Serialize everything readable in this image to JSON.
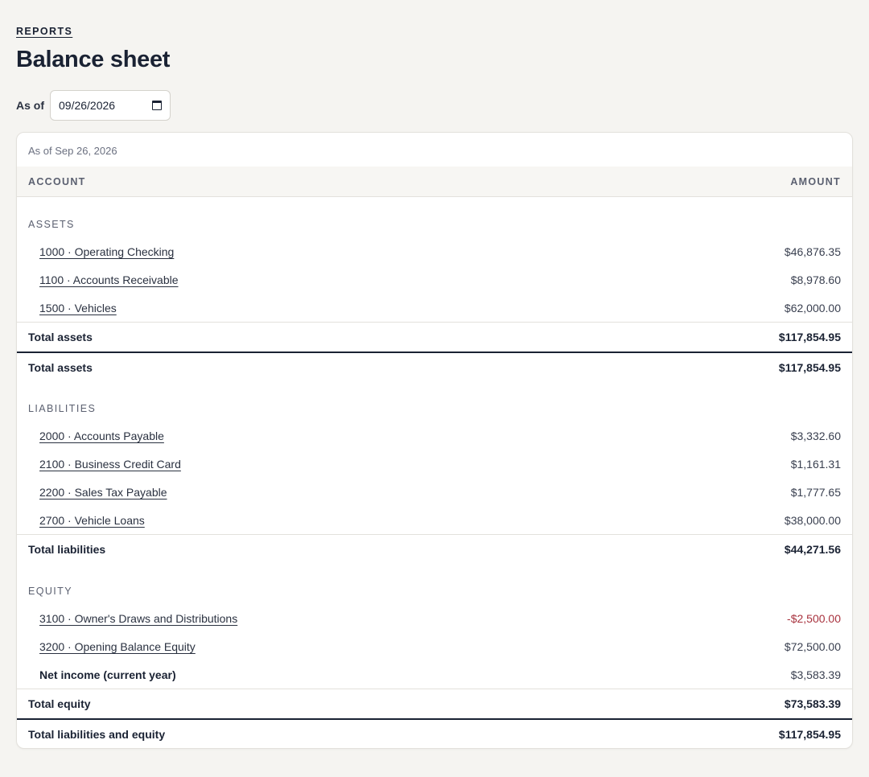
{
  "breadcrumb": "REPORTS",
  "page_title": "Balance sheet",
  "filter": {
    "label": "As of",
    "date_value": "09/26/2026"
  },
  "report": {
    "as_of_text": "As of Sep 26, 2026",
    "columns": {
      "account": "ACCOUNT",
      "amount": "AMOUNT"
    },
    "assets": {
      "heading": "ASSETS",
      "rows": [
        {
          "account": "1000 · Operating Checking",
          "amount": "$46,876.35"
        },
        {
          "account": "1100 · Accounts Receivable",
          "amount": "$8,978.60"
        },
        {
          "account": "1500 · Vehicles",
          "amount": "$62,000.00"
        }
      ],
      "total_label": "Total assets",
      "total_amount": "$117,854.95"
    },
    "grand_assets": {
      "label": "Total assets",
      "amount": "$117,854.95"
    },
    "liabilities": {
      "heading": "LIABILITIES",
      "rows": [
        {
          "account": "2000 · Accounts Payable",
          "amount": "$3,332.60"
        },
        {
          "account": "2100 · Business Credit Card",
          "amount": "$1,161.31"
        },
        {
          "account": "2200 · Sales Tax Payable",
          "amount": "$1,777.65"
        },
        {
          "account": "2700 · Vehicle Loans",
          "amount": "$38,000.00"
        }
      ],
      "total_label": "Total liabilities",
      "total_amount": "$44,271.56"
    },
    "equity": {
      "heading": "EQUITY",
      "rows": [
        {
          "account": "3100 · Owner's Draws and Distributions",
          "amount": "-$2,500.00"
        },
        {
          "account": "3200 · Opening Balance Equity",
          "amount": "$72,500.00"
        }
      ],
      "net_income_label": "Net income (current year)",
      "net_income_amount": "$3,583.39",
      "total_label": "Total equity",
      "total_amount": "$73,583.39"
    },
    "grand_liab_equity": {
      "label": "Total liabilities and equity",
      "amount": "$117,854.95"
    },
    "colors": {
      "negative": "#a8323e",
      "text": "#1a2233"
    }
  }
}
